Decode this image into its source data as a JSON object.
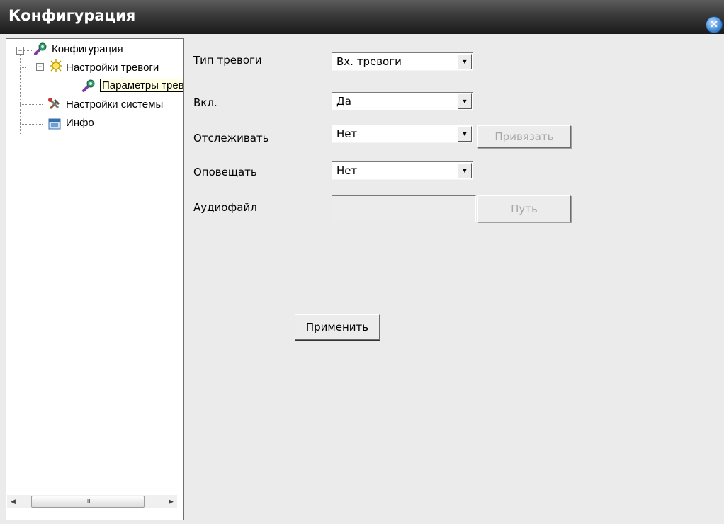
{
  "window": {
    "title": "Конфигурация",
    "close_icon": "close-icon"
  },
  "tree": {
    "root": {
      "label": "Конфигурация",
      "expander": "−",
      "icon": "config-icon"
    },
    "alarm_settings": {
      "label": "Настройки тревоги",
      "expander": "−",
      "icon": "alarm-light-icon"
    },
    "alarm_params": {
      "label": "Параметры тревоги",
      "icon": "config-icon",
      "selected": true
    },
    "system_settings": {
      "label": "Настройки системы",
      "icon": "tools-icon"
    },
    "info": {
      "label": "Инфо",
      "icon": "info-window-icon"
    },
    "scrollbar": {
      "left_arrow": "◀",
      "right_arrow": "▶",
      "thumb_grip": "III"
    }
  },
  "form": {
    "alarm_type": {
      "label": "Тип тревоги",
      "value": "Вх. тревоги"
    },
    "enable": {
      "label": "Вкл.",
      "value": "Да"
    },
    "track": {
      "label": "Отслеживать",
      "value": "Нет",
      "bind_button": "Привязать"
    },
    "notify": {
      "label": "Оповещать",
      "value": "Нет"
    },
    "audio": {
      "label": "Аудиофайл",
      "value": "",
      "path_button": "Путь"
    },
    "apply_button": "Применить",
    "dropdown_arrow": "▼"
  },
  "colors": {
    "title_bar": "#2a2a2a",
    "background": "#ebebeb",
    "selected_bg": "#ffffe1"
  }
}
